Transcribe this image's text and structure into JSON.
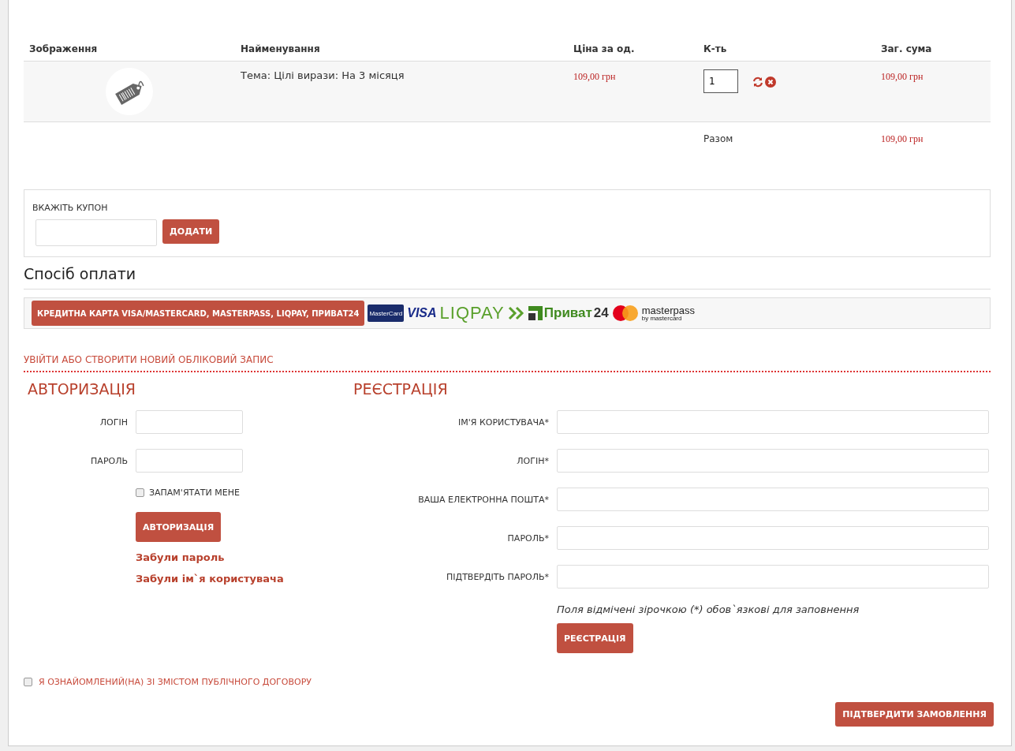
{
  "cart": {
    "columns": [
      "Зображення",
      "Найменування",
      "Ціна за од.",
      "К-ть",
      "Заг. сума"
    ],
    "rows": [
      {
        "name": "Тема: Цілі вирази: На 3 місяця",
        "price": "109,00 грн",
        "quantity": "1",
        "total": "109,00 грн"
      }
    ],
    "summary": {
      "label": "Разом",
      "value": "109,00 грн"
    }
  },
  "coupon": {
    "label": "ВКАЖІТЬ КУПОН",
    "button": "ДОДАТИ"
  },
  "payment": {
    "title": "Спосіб оплати",
    "method": "КРЕДИТНА КАРТА VISA/MASTERCARD, MASTERPASS, LIQPAY, ПРИВАТ24",
    "logos": [
      {
        "kind": "mastercard",
        "text": "MasterCard"
      },
      {
        "kind": "visa",
        "text": "VISA"
      },
      {
        "kind": "liqpay",
        "text": "LIQPAY"
      },
      {
        "kind": "privat",
        "text": "Приват",
        "suffix": "24"
      },
      {
        "kind": "masterpass",
        "text": "masterpass",
        "subtext": "by mastercard"
      }
    ]
  },
  "account": {
    "heading": "УВІЙТИ АБО СТВОРИТИ НОВИЙ ОБЛІКОВИЙ ЗАПИС",
    "login": {
      "title": "АВТОРИЗАЦІЯ",
      "fields": [
        "ЛОГІН",
        "ПАРОЛЬ"
      ],
      "remember": {
        "label": "ЗАПАМ'ЯТАТИ МЕНЕ",
        "checked": false
      },
      "button": "АВТОРИЗАЦІЯ",
      "links": [
        "Забули пароль",
        "Забули ім`я користувача"
      ]
    },
    "register": {
      "title": "РЕЄСТРАЦІЯ",
      "fields": [
        "ІМ'Я КОРИСТУВАЧА*",
        "ЛОГІН*",
        "ВАША ЕЛЕКТРОННА ПОШТА*",
        "ПАРОЛЬ*",
        "ПІДТВЕРДІТЬ ПАРОЛЬ*"
      ],
      "note": "Поля відмічені зірочкою (*) обов`язкові для заповнення",
      "button": "РЕЄСТРАЦІЯ"
    }
  },
  "agreement": {
    "label": "Я ОЗНАЙОМЛЕНИЙ(НА) ЗІ ЗМІСТОМ ПУБЛІЧНОГО ДОГОВОРУ",
    "checked": false
  },
  "confirm_button": "ПІДТВЕРДИТИ ЗАМОВЛЕННЯ"
}
